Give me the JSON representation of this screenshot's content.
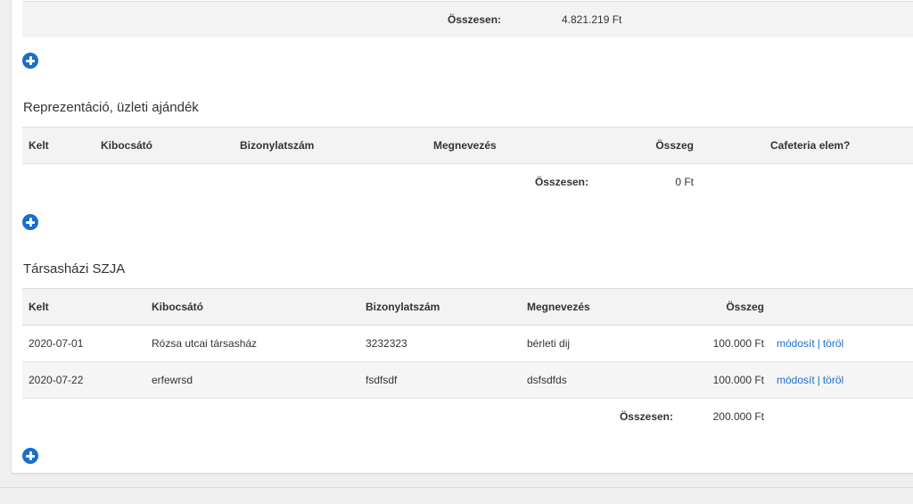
{
  "top_section": {
    "total_label": "Összesen:",
    "total_value": "4.821.219 Ft"
  },
  "representation": {
    "title": "Reprezentáció, üzleti ajándék",
    "headers": [
      "Kelt",
      "Kibocsátó",
      "Bizonylatszám",
      "Megnevezés",
      "Összeg",
      "Cafeteria elem?"
    ],
    "total_label": "Összesen:",
    "total_value": "0 Ft"
  },
  "condo": {
    "title": "Társasházi SZJA",
    "headers": [
      "Kelt",
      "Kibocsátó",
      "Bizonylatszám",
      "Megnevezés",
      "Összeg"
    ],
    "rows": [
      {
        "kelt": "2020-07-01",
        "kibocsato": "Rózsa utcai társasház",
        "bizonylatszam": "3232323",
        "megnevezes": "bérleti dij",
        "osszeg": "100.000 Ft",
        "edit": "módosít",
        "sep": "|",
        "delete": "töröl"
      },
      {
        "kelt": "2020-07-22",
        "kibocsato": "erfewrsd",
        "bizonylatszam": "fsdfsdf",
        "megnevezes": "dsfsdfds",
        "osszeg": "100.000 Ft",
        "edit": "módosít",
        "sep": "|",
        "delete": "töröl"
      }
    ],
    "total_label": "Összesen:",
    "total_value": "200.000 Ft"
  },
  "icons": {
    "add": "plus-circle-icon"
  },
  "colors": {
    "accent": "#1a6fc9",
    "header_bg": "#f3f3f3"
  }
}
